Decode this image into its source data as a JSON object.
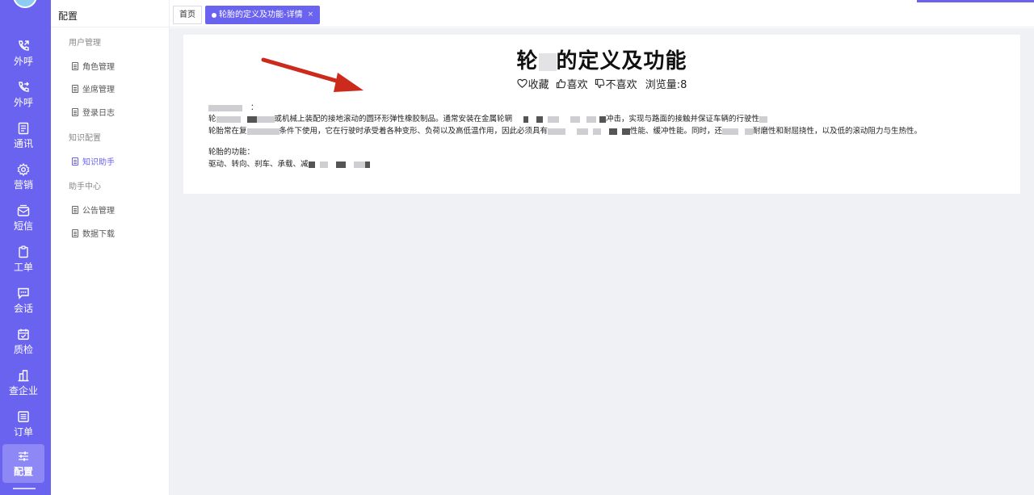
{
  "rail": {
    "items": [
      {
        "label": "外呼",
        "icon": "phone-out-icon"
      },
      {
        "label": "外呼",
        "icon": "phone-forward-icon"
      },
      {
        "label": "通讯",
        "icon": "contacts-icon"
      },
      {
        "label": "营销",
        "icon": "gear-icon"
      },
      {
        "label": "短信",
        "icon": "message-box-icon"
      },
      {
        "label": "工单",
        "icon": "clipboard-icon"
      },
      {
        "label": "会话",
        "icon": "chat-icon"
      },
      {
        "label": "质检",
        "icon": "calendar-check-icon"
      },
      {
        "label": "查企业",
        "icon": "building-icon"
      },
      {
        "label": "订单",
        "icon": "list-icon"
      },
      {
        "label": "配置",
        "icon": "sliders-icon"
      }
    ],
    "active": "配置"
  },
  "menu": {
    "title": "配置",
    "groups": [
      {
        "label": "用户管理",
        "items": [
          "角色管理",
          "坐席管理",
          "登录日志"
        ]
      },
      {
        "label": "知识配置",
        "items": [
          "知识助手"
        ]
      },
      {
        "label": "助手中心",
        "items": [
          "公告管理",
          "数据下载"
        ]
      }
    ],
    "active_item": "知识助手"
  },
  "tabs": {
    "home": "首页",
    "active": "轮胎的定义及功能-详情",
    "close": "×"
  },
  "article": {
    "title_pre": "轮",
    "title_post": "的定义及功能",
    "favorite": "收藏",
    "like": "喜欢",
    "dislike": "不喜欢",
    "views": "浏览量:8",
    "para_colon": "：",
    "line1_a": "轮",
    "line1_b": "或机械上装配的接地滚动的圆环形弹性橡胶制品。通常安装在金属轮辋",
    "line1_c": "冲击，实现与路面的接触并保证车辆的行驶性",
    "line2_a": "轮胎常在复",
    "line2_b": "条件下使用，它在行驶时承受着各种变形、负荷以及高低温作用，因此必须具有",
    "line2_c": "性能、缓冲性能。同时，还",
    "line2_d": "耐磨性和耐屈挠性，以及低的滚动阻力与生热性。",
    "func_label": "轮胎的功能：",
    "func_line": "驱动、转向、刹车、承载、减"
  },
  "colors": {
    "rail": "#6a63f0",
    "accent": "#6a63f0",
    "content_bg": "#f0f1f5",
    "arrow": "#cc2a1c"
  }
}
